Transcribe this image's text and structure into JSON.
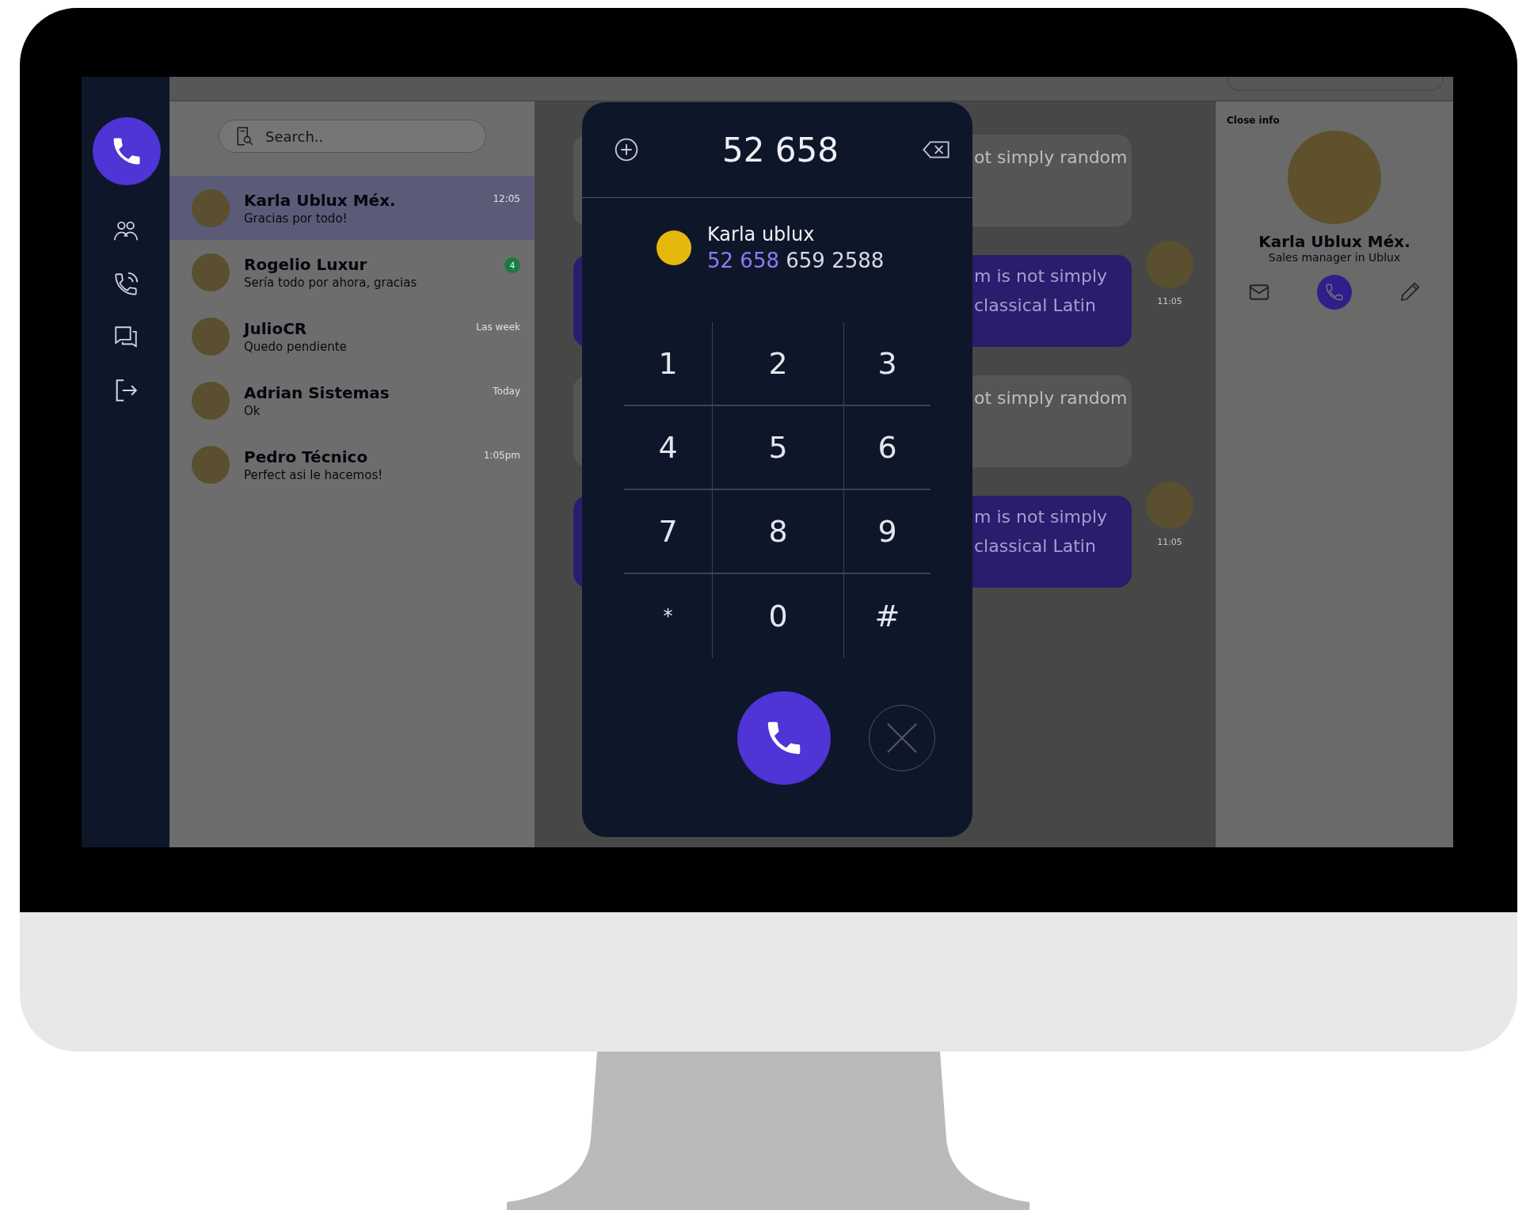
{
  "search": {
    "placeholder": "Search.."
  },
  "conversations": [
    {
      "name": "Karla Ublux Méx.",
      "preview": "Gracias por todo!",
      "time": "12:05",
      "selected": true
    },
    {
      "name": "Rogelio Luxur",
      "preview": "Sería todo por ahora, gracias",
      "badge": "4",
      "selected": false
    },
    {
      "name": "JulioCR",
      "preview": "Quedo pendiente",
      "time": "Las week",
      "selected": false
    },
    {
      "name": "Adrian Sistemas",
      "preview": "Ok",
      "time": "Today",
      "selected": false
    },
    {
      "name": "Pedro Técnico",
      "preview": "Perfect asi le hacemos!",
      "time": "1:05pm",
      "selected": false
    }
  ],
  "messages": [
    {
      "kind": "received",
      "lines": [
        "ot simply random"
      ]
    },
    {
      "kind": "sent",
      "lines": [
        "m is not simply",
        "classical Latin"
      ],
      "time": "11:05"
    },
    {
      "kind": "received",
      "lines": [
        "ot simply random"
      ]
    },
    {
      "kind": "sent",
      "lines": [
        "m is not simply",
        "classical Latin"
      ],
      "time": "11:05"
    }
  ],
  "contact_info": {
    "close_label": "Close info",
    "name": "Karla Ublux Méx.",
    "subtitle": "Sales manager in Ublux"
  },
  "dialer": {
    "number": "52 658",
    "match": {
      "name": "Karla ublux",
      "number_match": "52 658",
      "number_rest": "659 2588"
    },
    "keys": [
      "1",
      "2",
      "3",
      "4",
      "5",
      "6",
      "7",
      "8",
      "9",
      "*",
      "0",
      "#"
    ]
  }
}
